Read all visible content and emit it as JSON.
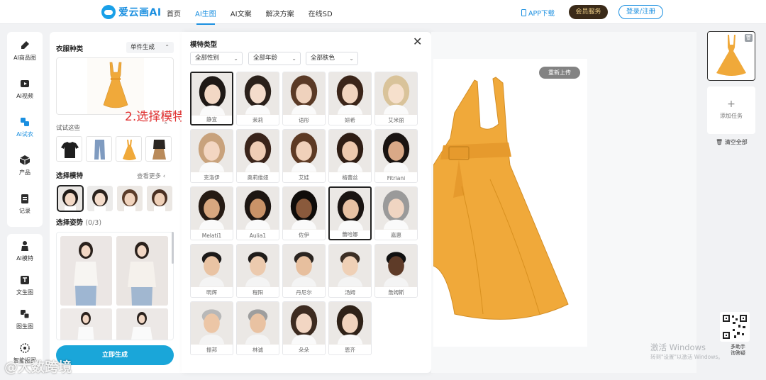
{
  "brand": {
    "name": "爱云画AI",
    "accent": "#1a8fe0"
  },
  "nav": [
    "首页",
    "AI生图",
    "AI文案",
    "解决方案",
    "在线SD"
  ],
  "nav_active": 1,
  "header": {
    "app_download": "APP下载",
    "vip": "会员服务",
    "login": "登录/注册"
  },
  "sidebar_top": [
    {
      "label": "AI商品图",
      "icon": "brush-icon"
    },
    {
      "label": "AI视频",
      "icon": "video-icon"
    },
    {
      "label": "AI试衣",
      "icon": "shirt-icon",
      "active": true
    },
    {
      "label": "产品",
      "icon": "cube-icon"
    },
    {
      "label": "记录",
      "icon": "clipboard-icon"
    }
  ],
  "sidebar_bottom": [
    {
      "label": "AI模特",
      "icon": "person-icon"
    },
    {
      "label": "文生图",
      "icon": "text-image-icon"
    },
    {
      "label": "图生图",
      "icon": "image-image-icon"
    },
    {
      "label": "智能抠图",
      "icon": "cutout-icon"
    }
  ],
  "left": {
    "clothing_type_title": "衣服种类",
    "mode_dropdown": "单件生成",
    "annotation": "2.选择模特",
    "try_these": "试试这些",
    "select_model_title": "选择模特",
    "view_more": "查看更多",
    "select_pose_title": "选择姿势",
    "pose_count": "(0/3)",
    "generate": "立即生成"
  },
  "modal": {
    "title": "模特类型",
    "filters": [
      "全部性别",
      "全部年龄",
      "全部肤色"
    ],
    "models": [
      {
        "name": "静宜",
        "selected": true
      },
      {
        "name": "茉莉"
      },
      {
        "name": "语彤"
      },
      {
        "name": "妍希"
      },
      {
        "name": "艾米丽"
      },
      {
        "name": "克洛伊"
      },
      {
        "name": "奥莉维娅"
      },
      {
        "name": "艾娃"
      },
      {
        "name": "格蕾丝"
      },
      {
        "name": "Fitriani"
      },
      {
        "name": "Melati1"
      },
      {
        "name": "Aulia1"
      },
      {
        "name": "佐伊"
      },
      {
        "name": "蕾哈娜",
        "selected": true
      },
      {
        "name": "嘉惠"
      },
      {
        "name": "明辉"
      },
      {
        "name": "程阳"
      },
      {
        "name": "丹尼尔"
      },
      {
        "name": "汤姆"
      },
      {
        "name": "詹姆斯"
      },
      {
        "name": "振邦"
      },
      {
        "name": "林诚"
      },
      {
        "name": "朵朵"
      },
      {
        "name": "恩齐"
      }
    ]
  },
  "canvas": {
    "reupload": "重新上传",
    "dress_color": "#f0a93a"
  },
  "right": {
    "add_task": "添加任务",
    "clear_all": "清空全部",
    "assistant": "多助手\n询答疑"
  },
  "overlay": {
    "windows_line1": "激活 Windows",
    "windows_line2": "转到\"设置\"以激活 Windows。",
    "watermark": "@大数跨境"
  }
}
